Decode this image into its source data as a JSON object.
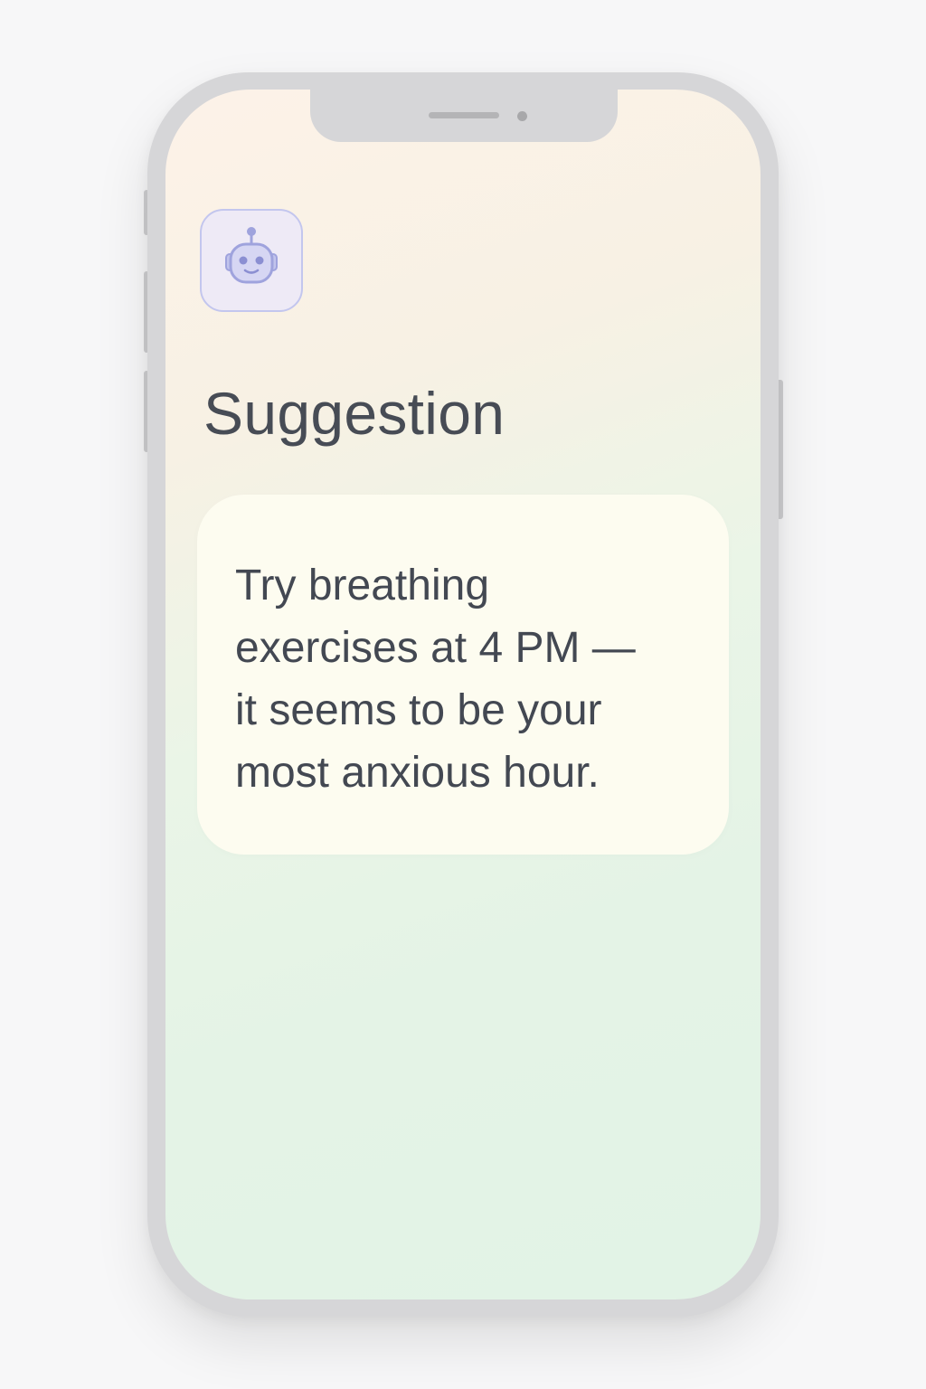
{
  "app": {
    "assistant_icon": "robot-icon",
    "title": "Suggestion"
  },
  "suggestion": {
    "text": "Try breathing\nexercises at 4 PM —\nit seems to be your\nmost anxious hour."
  },
  "colors": {
    "title_text": "#474c55",
    "body_text": "#434852",
    "icon_accent": "#9fa3dd",
    "card_background": "#fdfcf0",
    "screen_gradient_top": "#fdf2e8",
    "screen_gradient_bottom": "#e2f3e6"
  }
}
